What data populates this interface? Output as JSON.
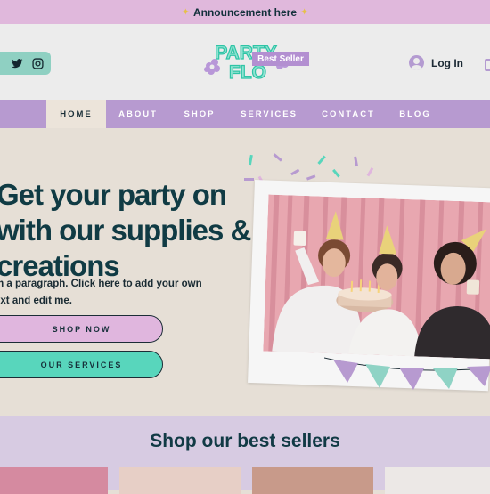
{
  "announcement": {
    "text": "Announcement here",
    "star_icon": "star-icon"
  },
  "header": {
    "social": [
      {
        "name": "twitter-icon"
      },
      {
        "name": "instagram-icon"
      }
    ],
    "logo": {
      "line1": "PARTY",
      "line2": "FLO",
      "color_fill": "#8fe3d1",
      "color_outline": "#2fc4a6",
      "flower_color": "#b897d8"
    },
    "login_label": "Log In"
  },
  "nav": {
    "items": [
      {
        "label": "HOME",
        "active": true
      },
      {
        "label": "ABOUT"
      },
      {
        "label": "SHOP"
      },
      {
        "label": "SERVICES"
      },
      {
        "label": "CONTACT"
      },
      {
        "label": "BLOG"
      }
    ]
  },
  "hero": {
    "headline": "Get your party on with our supplies & creations",
    "paragraph": "m a paragraph. Click here to add your own\next and edit me.",
    "shop_button": "SHOP NOW",
    "services_button": "OUR SERVICES"
  },
  "sellers": {
    "title": "Shop our best sellers",
    "badge": "Best Seller"
  },
  "colors": {
    "announcement_bg": "#e0b8dc",
    "nav_bg": "#b79ad0",
    "hero_bg": "#e6dfd6",
    "teal_accent": "#58d6bc",
    "pink_accent": "#e0b6de",
    "headline_color": "#103b44"
  }
}
